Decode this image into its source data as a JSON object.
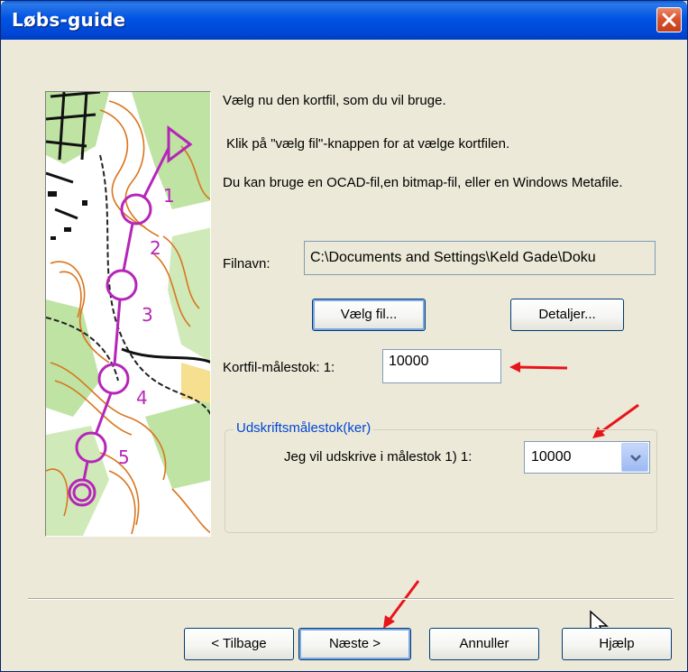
{
  "window": {
    "title": "Løbs-guide"
  },
  "intro": {
    "line1": "Vælg nu den kortfil, som du vil bruge.",
    "line2": "Klik på \"vælg fil\"-knappen for at vælge kortfilen.",
    "line3": "Du kan bruge en OCAD-fil,en bitmap-fil, eller en Windows Metafile."
  },
  "file": {
    "label": "Filnavn:",
    "value": "C:\\Documents and Settings\\Keld Gade\\Doku"
  },
  "buttons": {
    "choose_file": "Vælg fil...",
    "details": "Detaljer...",
    "back": "< Tilbage",
    "next": "Næste >",
    "cancel": "Annuller",
    "help": "Hjælp"
  },
  "scale": {
    "label": "Kortfil-målestok:  1:",
    "value": "10000"
  },
  "print_group": {
    "legend": "Udskriftsmålestok(ker)",
    "label": "Jeg vil udskrive i målestok 1)  1:",
    "selected": "10000"
  },
  "colors": {
    "titlebar": "#0054e3",
    "annotation_arrow": "#e8141b",
    "course_purple": "#b526b8",
    "map_contour": "#d9751e",
    "map_green": "#bfe3a3"
  },
  "icons": {
    "close": "close-icon",
    "dropdown": "chevron-down-icon",
    "pointer": "mouse-cursor-icon"
  }
}
